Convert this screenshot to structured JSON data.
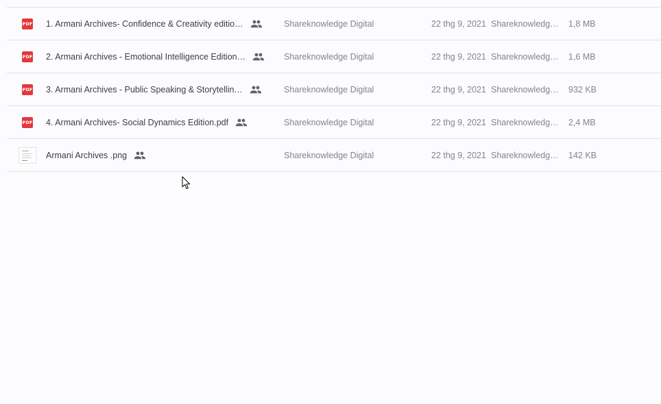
{
  "files": [
    {
      "name": "1. Armani Archives- Confidence & Creativity editio…",
      "type": "pdf",
      "owner": "Shareknowledge Digital",
      "modified": "22 thg 9, 2021",
      "modified_by": "Shareknowledg…",
      "size": "1,8 MB",
      "shared": true
    },
    {
      "name": "2. Armani Archives - Emotional Intelligence Edition…",
      "type": "pdf",
      "owner": "Shareknowledge Digital",
      "modified": "22 thg 9, 2021",
      "modified_by": "Shareknowledg…",
      "size": "1,6 MB",
      "shared": true
    },
    {
      "name": "3. Armani Archives - Public Speaking & Storytellin…",
      "type": "pdf",
      "owner": "Shareknowledge Digital",
      "modified": "22 thg 9, 2021",
      "modified_by": "Shareknowledg…",
      "size": "932 KB",
      "shared": true
    },
    {
      "name": "4. Armani Archives- Social Dynamics Edition.pdf",
      "type": "pdf",
      "owner": "Shareknowledge Digital",
      "modified": "22 thg 9, 2021",
      "modified_by": "Shareknowledg…",
      "size": "2,4 MB",
      "shared": true
    },
    {
      "name": "Armani Archives .png",
      "type": "png",
      "owner": "Shareknowledge Digital",
      "modified": "22 thg 9, 2021",
      "modified_by": "Shareknowledg…",
      "size": "142 KB",
      "shared": true
    }
  ],
  "icons": {
    "pdf": "pdf-file-icon",
    "png": "image-thumbnail-icon",
    "shared": "shared-people-icon",
    "cursor": "mouse-pointer-icon"
  },
  "pdf_badge_text": "PDF",
  "colors": {
    "pdf_red": "#e0393e",
    "text_primary": "#3c4043",
    "text_secondary": "#80868b",
    "divider": "#e0e0e0",
    "background": "#fcfbfe"
  }
}
